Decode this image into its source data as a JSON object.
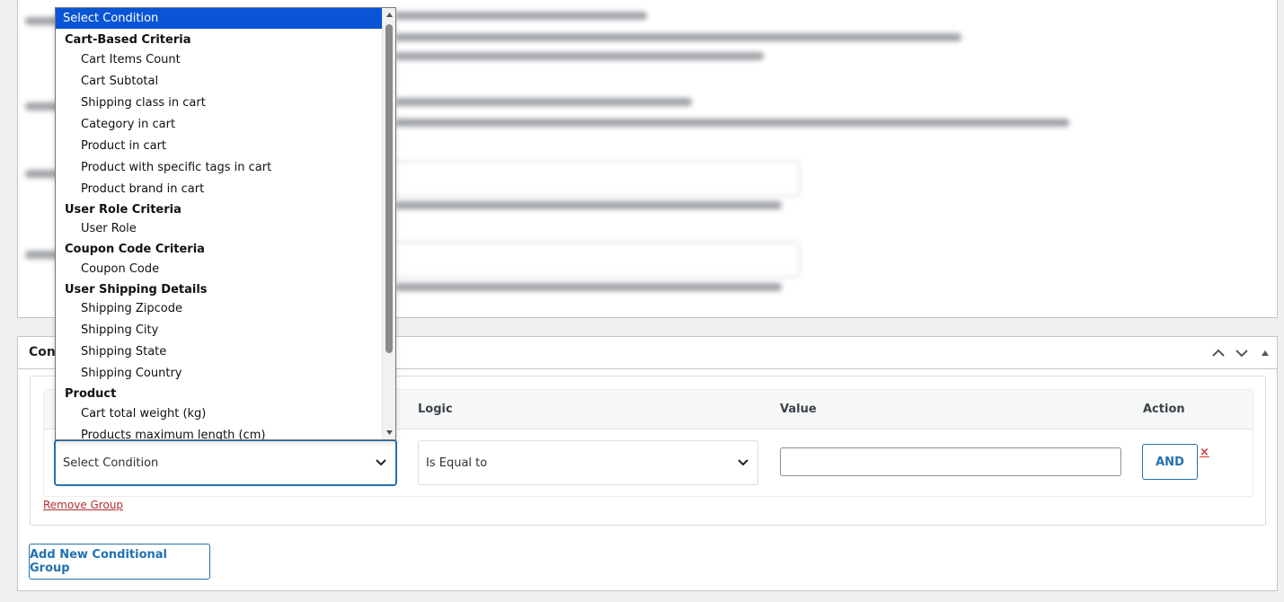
{
  "conditions_panel": {
    "title": "Conditions",
    "title_visible": "Cond",
    "columns": {
      "logic": "Logic",
      "value": "Value",
      "action": "Action"
    },
    "row": {
      "condition_selected": "Select Condition",
      "logic_selected": "Is Equal to",
      "value": "",
      "and_label": "AND",
      "delete_label": "×"
    },
    "remove_group_label": "Remove Group",
    "add_group_label": "Add New Conditional Group"
  },
  "dropdown": {
    "options": [
      {
        "label": "Select Condition",
        "kind": "selected"
      },
      {
        "label": "Cart-Based Criteria",
        "kind": "group"
      },
      {
        "label": "Cart Items Count",
        "kind": "item"
      },
      {
        "label": "Cart Subtotal",
        "kind": "item"
      },
      {
        "label": "Shipping class in cart",
        "kind": "item"
      },
      {
        "label": "Category in cart",
        "kind": "item"
      },
      {
        "label": "Product in cart",
        "kind": "item"
      },
      {
        "label": "Product with specific tags in cart",
        "kind": "item"
      },
      {
        "label": "Product brand in cart",
        "kind": "item"
      },
      {
        "label": "User Role Criteria",
        "kind": "group"
      },
      {
        "label": "User Role",
        "kind": "item"
      },
      {
        "label": "Coupon Code Criteria",
        "kind": "group"
      },
      {
        "label": "Coupon Code",
        "kind": "item"
      },
      {
        "label": "User Shipping Details",
        "kind": "group"
      },
      {
        "label": "Shipping Zipcode",
        "kind": "item"
      },
      {
        "label": "Shipping City",
        "kind": "item"
      },
      {
        "label": "Shipping State",
        "kind": "item"
      },
      {
        "label": "Shipping Country",
        "kind": "item"
      },
      {
        "label": "Product",
        "kind": "group"
      },
      {
        "label": "Cart total weight (kg)",
        "kind": "item"
      },
      {
        "label": "Products maximum length (cm)",
        "kind": "item"
      }
    ]
  },
  "colors": {
    "accent": "#2271b1",
    "selected_option": "#0a55d6",
    "danger": "#d63638"
  }
}
